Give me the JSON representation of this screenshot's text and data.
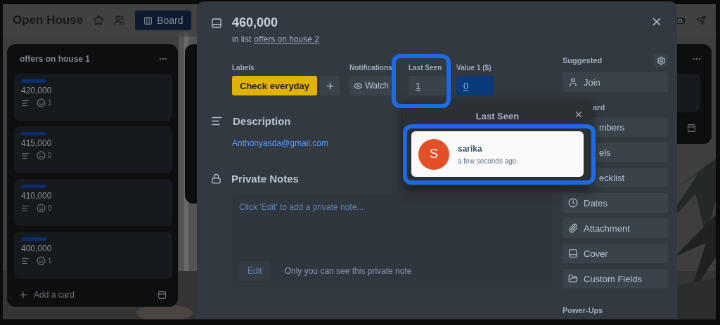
{
  "board": {
    "title": "Open House",
    "view_button": "Board",
    "badge": "21",
    "lists": [
      {
        "title": "offers on house 1",
        "add_card": "Add a card",
        "cards": [
          {
            "title": "420,000",
            "reactions": "1"
          },
          {
            "title": "415,000",
            "reactions": "0"
          },
          {
            "title": "410,000",
            "reactions": "0"
          },
          {
            "title": "400,000",
            "reactions": "1"
          }
        ]
      }
    ]
  },
  "card_modal": {
    "title": "460,000",
    "list_prefix": "in list",
    "list_link": "offers on house 2",
    "fields": [
      {
        "kind": "label",
        "label": "Labels",
        "value": "Check everyday"
      },
      {
        "kind": "watch",
        "label": "Notifications",
        "value": "Watch"
      },
      {
        "kind": "custom",
        "label": "Last Seen",
        "value": "1",
        "active": false
      },
      {
        "kind": "custom",
        "label": "Value 1 ($)",
        "value": "0",
        "active": true
      }
    ],
    "description": {
      "heading": "Description",
      "text": "Anthonyasda@gmail.com"
    },
    "private_notes": {
      "heading": "Private Notes",
      "placeholder": "Click 'Edit' to add a private note...",
      "edit_button": "Edit",
      "note": "Only you can see this private note"
    },
    "sidebar": {
      "suggested_label": "Suggested",
      "join": "Join",
      "add_label": "ard",
      "power_ups_label": "Power-Ups",
      "actions": [
        {
          "label": "mbers",
          "covered": true
        },
        {
          "label": "els",
          "covered": true
        },
        {
          "label": "ecklist",
          "covered": true
        },
        {
          "label": "Dates",
          "covered": false
        },
        {
          "label": "Attachment",
          "covered": false
        },
        {
          "label": "Cover",
          "covered": false
        },
        {
          "label": "Custom Fields",
          "covered": false
        }
      ]
    }
  },
  "popover": {
    "title": "Last Seen",
    "users": [
      {
        "initial": "S",
        "name": "sarika",
        "time": "a few seconds ago"
      }
    ]
  }
}
